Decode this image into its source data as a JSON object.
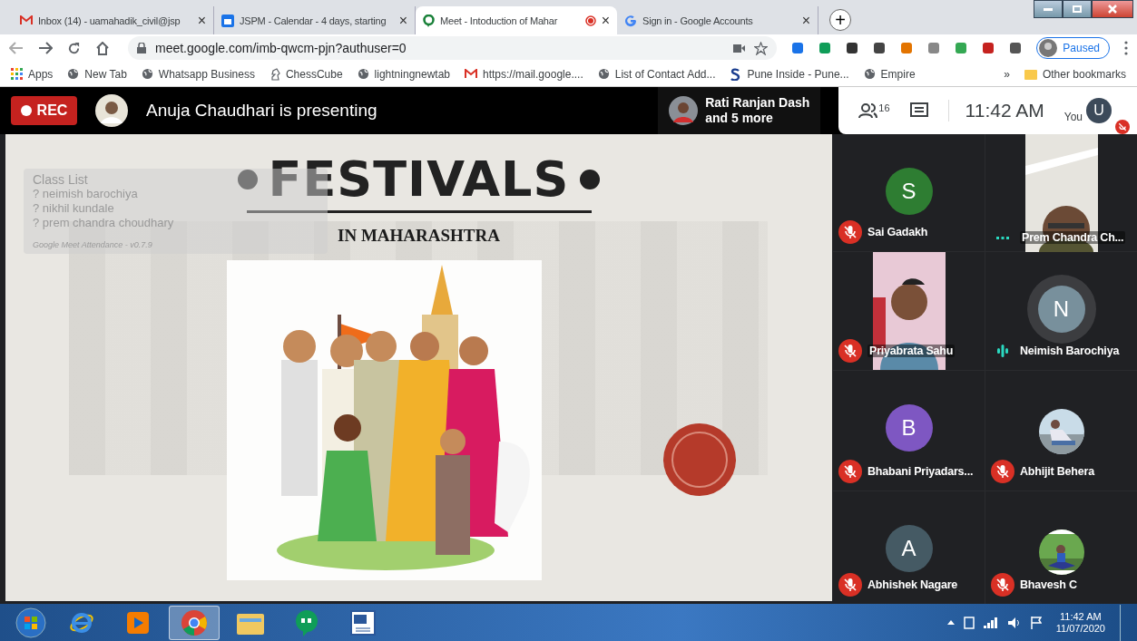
{
  "browser": {
    "tabs": [
      {
        "title": "Inbox (14) - uamahadik_civil@jsp",
        "close": "×",
        "selected": false,
        "recording": false
      },
      {
        "title": "JSPM - Calendar - 4 days, starting",
        "close": "×",
        "selected": false,
        "recording": false
      },
      {
        "title": "Meet - Intoduction of Mahar",
        "close": "×",
        "selected": true,
        "recording": true
      },
      {
        "title": "Sign in - Google Accounts",
        "close": "×",
        "selected": false,
        "recording": false
      }
    ],
    "new_tab": "+",
    "address": "meet.google.com/imb-qwcm-pjn?authuser=0",
    "profile": "Paused",
    "bookmarks": [
      "Apps",
      "New Tab",
      "Whatsapp Business",
      "ChessCube",
      "lightningnewtab",
      "https://mail.google....",
      "List of Contact Add...",
      "Pune Inside - Pune...",
      "Empire"
    ],
    "more_bookmarks": "»",
    "other_bookmarks": "Other bookmarks"
  },
  "meet": {
    "rec": "REC",
    "presenter": "Anuja Chaudhari is presenting",
    "speakers": [
      "Rati Ranjan Dash",
      "and 5 more"
    ],
    "people_count": "16",
    "time": "11:42 AM",
    "self_initial": "U",
    "self_label": "You",
    "slide": {
      "title": "FESTIVALS",
      "subtitle": "IN MAHARASHTRA",
      "overlay": {
        "title": "Class List",
        "names": [
          "? neimish barochiya",
          "? nikhil kundale",
          "? prem chandra choudhary"
        ],
        "footer": "Google Meet Attendance - v0.7.9"
      }
    },
    "participants": [
      {
        "name": "Sai Gadakh",
        "kind": "letter",
        "initial": "S",
        "color": "#2e7d32",
        "muted": true,
        "speaking": false
      },
      {
        "name": "Prem Chandra Ch...",
        "kind": "video",
        "muted": false,
        "speaking": false
      },
      {
        "name": "Priyabrata Sahu",
        "kind": "video",
        "muted": true,
        "speaking": false
      },
      {
        "name": "Neimish Barochiya",
        "kind": "letter",
        "initial": "N",
        "color": "#78909c",
        "muted": false,
        "speaking": true
      },
      {
        "name": "Bhabani Priyadars...",
        "kind": "letter",
        "initial": "B",
        "color": "#7e57c2",
        "muted": true,
        "speaking": false
      },
      {
        "name": "Abhijit Behera",
        "muted": true,
        "speaking": false
      },
      {
        "name": "Abhishek Nagare",
        "kind": "letter",
        "initial": "A",
        "color": "#455a64",
        "muted": true,
        "speaking": false
      },
      {
        "name": "Bhavesh C",
        "muted": true,
        "speaking": false
      }
    ]
  },
  "taskbar": {
    "apps": [
      {
        "selected": false
      },
      {
        "selected": false
      },
      {
        "selected": false
      },
      {
        "selected": true
      },
      {
        "selected": false
      },
      {
        "selected": false
      },
      {
        "selected": false
      }
    ],
    "time": "11:42 AM",
    "date": "11/07/2020"
  }
}
